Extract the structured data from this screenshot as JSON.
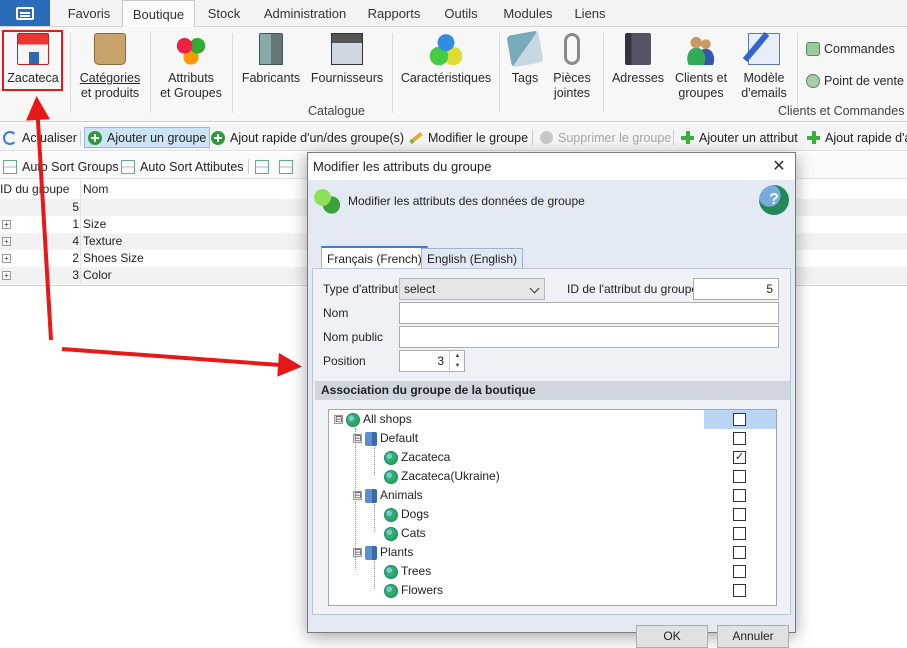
{
  "ribbon_tabs": [
    "Favoris",
    "Boutique",
    "Stock",
    "Administration",
    "Rapports",
    "Outils",
    "Modules",
    "Liens"
  ],
  "active_tab": "Boutique",
  "ribbon": {
    "shop_button": "Zacateca",
    "catalog_buttons": [
      {
        "l1": "Catégories",
        "l2": "et produits"
      },
      {
        "l1": "Attributs",
        "l2": "et Groupes"
      },
      {
        "l1": "Fabricants",
        "l2": ""
      },
      {
        "l1": "Fournisseurs",
        "l2": ""
      },
      {
        "l1": "Caractéristiques",
        "l2": ""
      },
      {
        "l1": "Tags",
        "l2": ""
      },
      {
        "l1": "Pièces",
        "l2": "jointes"
      }
    ],
    "catalog_group_label": "Catalogue",
    "client_buttons": [
      {
        "l1": "Adresses",
        "l2": ""
      },
      {
        "l1": "Clients et",
        "l2": "groupes"
      },
      {
        "l1": "Modèle",
        "l2": "d'emails"
      }
    ],
    "orders_label": "Commandes",
    "pos_label": "Point de vente",
    "clients_group_label": "Clients et Commandes"
  },
  "toolbar1": {
    "refresh": "Actualiser",
    "add_group": "Ajouter un groupe",
    "quick_add_group": "Ajout rapide d'un/des groupe(s)",
    "edit_group": "Modifier le groupe",
    "delete_group": "Supprimer le groupe",
    "add_attribute": "Ajouter un attribut",
    "quick_add_attribute": "Ajout rapide d'a"
  },
  "toolbar2": {
    "auto_sort_groups": "Auto Sort Groups",
    "auto_sort_attributes": "Auto Sort Attibutes"
  },
  "grid": {
    "col_id": "ID du groupe",
    "col_name": "Nom",
    "rows": [
      {
        "id": "5",
        "name": "",
        "expandable": false
      },
      {
        "id": "1",
        "name": "Size",
        "expandable": true
      },
      {
        "id": "4",
        "name": "Texture",
        "expandable": true
      },
      {
        "id": "2",
        "name": "Shoes Size",
        "expandable": true
      },
      {
        "id": "3",
        "name": "Color",
        "expandable": true
      }
    ]
  },
  "dialog": {
    "title": "Modifier les attributs du groupe",
    "header": "Modifier les attributs des données de groupe",
    "help": "?",
    "tabs": [
      "Français (French)",
      "English (English)"
    ],
    "type_label": "Type d'attribut",
    "type_value": "select",
    "id_label": "ID de l'attribut du groupe",
    "id_value": "5",
    "name_label": "Nom",
    "name_value": "",
    "public_name_label": "Nom public",
    "public_name_value": "",
    "position_label": "Position",
    "position_value": "3",
    "section_title": "Association du groupe de la boutique",
    "shops": [
      {
        "label": "All shops",
        "level": 0,
        "kind": "root",
        "checked": false,
        "expander": "⊟"
      },
      {
        "label": "Default",
        "level": 1,
        "kind": "group",
        "checked": false,
        "expander": "⊟"
      },
      {
        "label": "Zacateca",
        "level": 2,
        "kind": "shop",
        "checked": true,
        "expander": ""
      },
      {
        "label": "Zacateca(Ukraine)",
        "level": 2,
        "kind": "shop",
        "checked": false,
        "expander": ""
      },
      {
        "label": "Animals",
        "level": 1,
        "kind": "group",
        "checked": false,
        "expander": "⊟"
      },
      {
        "label": "Dogs",
        "level": 2,
        "kind": "shop",
        "checked": false,
        "expander": ""
      },
      {
        "label": "Cats",
        "level": 2,
        "kind": "shop",
        "checked": false,
        "expander": ""
      },
      {
        "label": "Plants",
        "level": 1,
        "kind": "group",
        "checked": false,
        "expander": "⊟"
      },
      {
        "label": "Trees",
        "level": 2,
        "kind": "shop",
        "checked": false,
        "expander": ""
      },
      {
        "label": "Flowers",
        "level": 2,
        "kind": "shop",
        "checked": false,
        "expander": ""
      }
    ],
    "ok": "OK",
    "cancel": "Annuler"
  },
  "colors": {
    "accent_blue": "#2b6cb8",
    "annotation_red": "#e81818",
    "dialog_bg": "#e3eaf3"
  }
}
